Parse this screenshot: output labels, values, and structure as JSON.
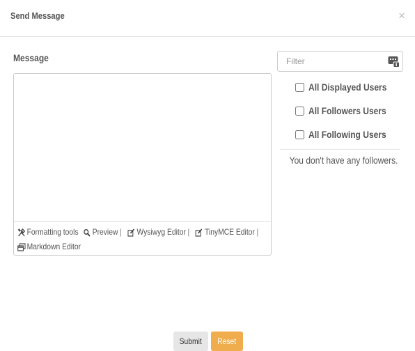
{
  "header": {
    "title": "Send Message",
    "close_symbol": "×"
  },
  "message": {
    "label": "Message",
    "value": ""
  },
  "toolbar": {
    "row1": [
      {
        "icon": "wrench-screwdriver-icon",
        "label": "Formatting tools"
      },
      {
        "icon": "magnifier-icon",
        "label": "Preview"
      },
      {
        "icon": "edit-icon",
        "label": "Wysiwyg Editor"
      },
      {
        "icon": "edit-icon",
        "label": "TinyMCE Editor"
      }
    ],
    "row2": [
      {
        "icon": "markdown-window-icon",
        "label": "Markdown Editor"
      }
    ],
    "separator": "|"
  },
  "filter": {
    "placeholder": "Filter",
    "icon": "filter-users-icon"
  },
  "checkboxes": [
    {
      "label": "All Displayed Users",
      "checked": false
    },
    {
      "label": "All Followers Users",
      "checked": false
    },
    {
      "label": "All Following Users",
      "checked": false
    }
  ],
  "empty_message": "You don't have any followers.",
  "buttons": {
    "submit": "Submit",
    "reset": "Reset"
  },
  "colors": {
    "reset_button": "#f0ad4e",
    "submit_button": "#e6e6e6",
    "border": "#cccccc"
  }
}
